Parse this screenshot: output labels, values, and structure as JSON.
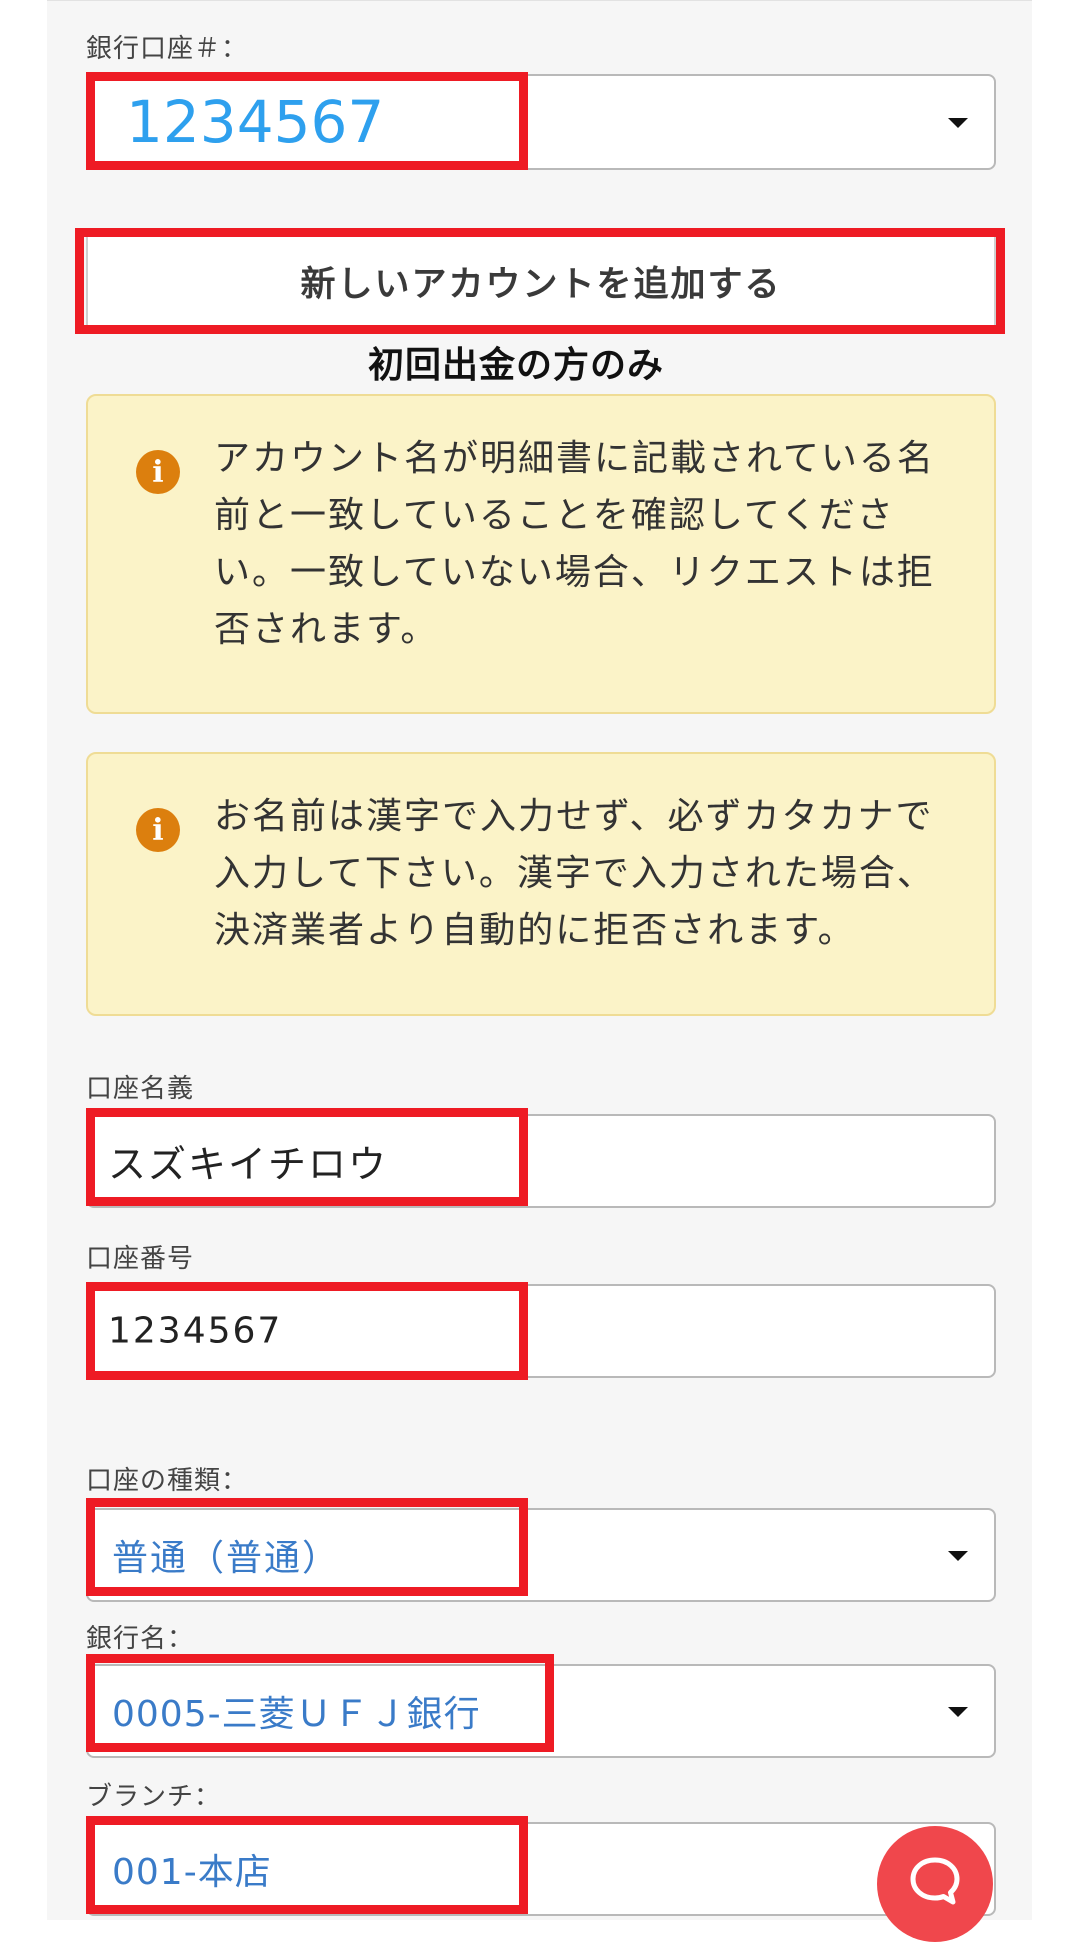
{
  "bank_account": {
    "label": "銀行口座＃：",
    "value": "1234567"
  },
  "add_account_button": "新しいアカウントを追加する",
  "first_withdrawal_note": "初回出金の方のみ",
  "notices": [
    {
      "icon": "info-icon",
      "text": "アカウント名が明細書に記載されている名前と一致していることを確認してください。一致していない場合、リクエストは拒否されます。"
    },
    {
      "icon": "info-icon",
      "text": "お名前は漢字で入力せず、必ずカタカナで入力して下さい。漢字で入力された場合、決済業者より自動的に拒否されます。"
    }
  ],
  "account_holder": {
    "label": "口座名義",
    "value": "スズキイチロウ"
  },
  "account_number": {
    "label": "口座番号",
    "value": "1234567"
  },
  "account_type": {
    "label": "口座の種類：",
    "value": "普通（普通）"
  },
  "bank_name": {
    "label": "銀行名：",
    "value": "0005-三菱ＵＦＪ銀行"
  },
  "branch": {
    "label": "ブランチ：",
    "value": "001-本店"
  },
  "colors": {
    "highlight": "#ee1b24",
    "link_blue": "#3a7bc8",
    "bright_blue": "#2ea0ee",
    "notice_bg": "#fbf3c8",
    "info_icon": "#dc7f0e",
    "chat_button": "#f0474c"
  },
  "chat_button_icon": "chat-bubble-icon"
}
